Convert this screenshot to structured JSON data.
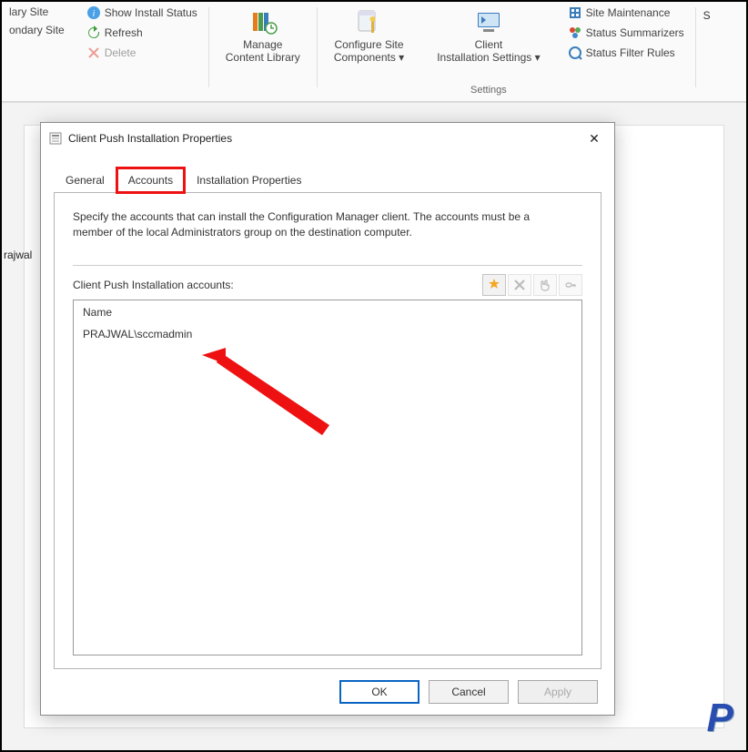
{
  "ribbon": {
    "col1": {
      "a": "lary Site",
      "b": "ondary Site"
    },
    "col2": {
      "show": "Show Install Status",
      "refresh": "Refresh",
      "delete": "Delete"
    },
    "manage": "Manage\nContent Library",
    "configure": "Configure Site\nComponents ▾",
    "client": "Client\nInstallation Settings ▾",
    "settings_group": "Settings",
    "col6": {
      "maint": "Site Maintenance",
      "summ": "Status Summarizers",
      "filter": "Status Filter Rules"
    },
    "cutoffS": "S"
  },
  "side": {
    "item": "rajwal"
  },
  "dialog": {
    "title": "Client Push Installation Properties",
    "tabs": {
      "general": "General",
      "accounts": "Accounts",
      "installprops": "Installation Properties"
    },
    "description": "Specify the accounts that can install the Configuration Manager client. The accounts must be a member of the local Administrators group on the destination computer.",
    "accounts_label": "Client Push Installation accounts:",
    "column_name": "Name",
    "account_row": "PRAJWAL\\sccmadmin",
    "buttons": {
      "ok": "OK",
      "cancel": "Cancel",
      "apply": "Apply"
    }
  }
}
